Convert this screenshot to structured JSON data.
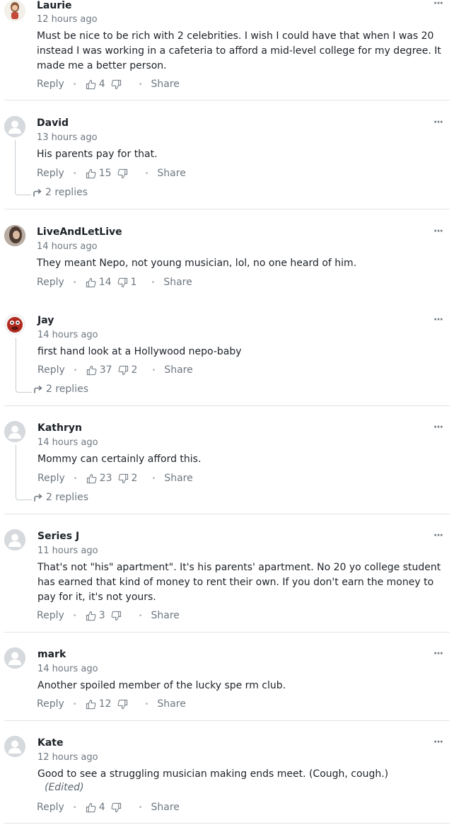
{
  "ui": {
    "reply_label": "Reply",
    "share_label": "Share",
    "menu_label": "···",
    "edited_label": "(Edited)"
  },
  "comments": [
    {
      "author": "Laurie",
      "time": "12 hours ago",
      "text": "Must be nice to be rich with 2 celebrities.  I wish I could have that when I was 20 instead I was working in a cafeteria to afford a mid-level college for my degree. It made me a better person.",
      "likes": "4",
      "dislikes": "",
      "replies": "",
      "avatar": "photo-laurie"
    },
    {
      "author": "David",
      "time": "13 hours ago",
      "text": "His parents pay for that.",
      "likes": "15",
      "dislikes": "",
      "replies": "2 replies",
      "avatar": "default-user-icon"
    },
    {
      "author": "LiveAndLetLive",
      "time": "14 hours ago",
      "text": "They meant Nepo, not young musician, lol, no one heard of him.",
      "likes": "14",
      "dislikes": "1",
      "replies": "",
      "avatar": "photo-liveandletlive"
    },
    {
      "author": "Jay",
      "time": "14 hours ago",
      "text": "first hand look at a Hollywood nepo-baby",
      "likes": "37",
      "dislikes": "2",
      "replies": "2 replies",
      "avatar": "photo-jay"
    },
    {
      "author": "Kathryn",
      "time": "14 hours ago",
      "text": "Mommy can certainly afford this.",
      "likes": "23",
      "dislikes": "2",
      "replies": "2 replies",
      "avatar": "default-user-icon"
    },
    {
      "author": "Series J",
      "time": "11 hours ago",
      "text": "That's not \"his\" apartment\".  It's his parents' apartment.  No 20 yo college student has earned that kind of money to rent their own.  If you don't earn the money to pay for it, it's not yours.",
      "likes": "3",
      "dislikes": "",
      "replies": "",
      "avatar": "default-user-icon"
    },
    {
      "author": "mark",
      "time": "14 hours ago",
      "text": "Another spoiled member of the lucky spe rm club.",
      "likes": "12",
      "dislikes": "",
      "replies": "",
      "avatar": "default-user-icon"
    },
    {
      "author": "Kate",
      "time": "12 hours ago",
      "text": "Good to see a struggling musician making ends meet. (Cough, cough.)",
      "likes": "4",
      "dislikes": "",
      "replies": "",
      "edited": true,
      "avatar": "default-user-icon"
    }
  ],
  "colors": {
    "text": "#1d2228",
    "muted": "#6e7780",
    "divider": "#e0e4e9",
    "avatar_bg": "#d6d9dd"
  }
}
